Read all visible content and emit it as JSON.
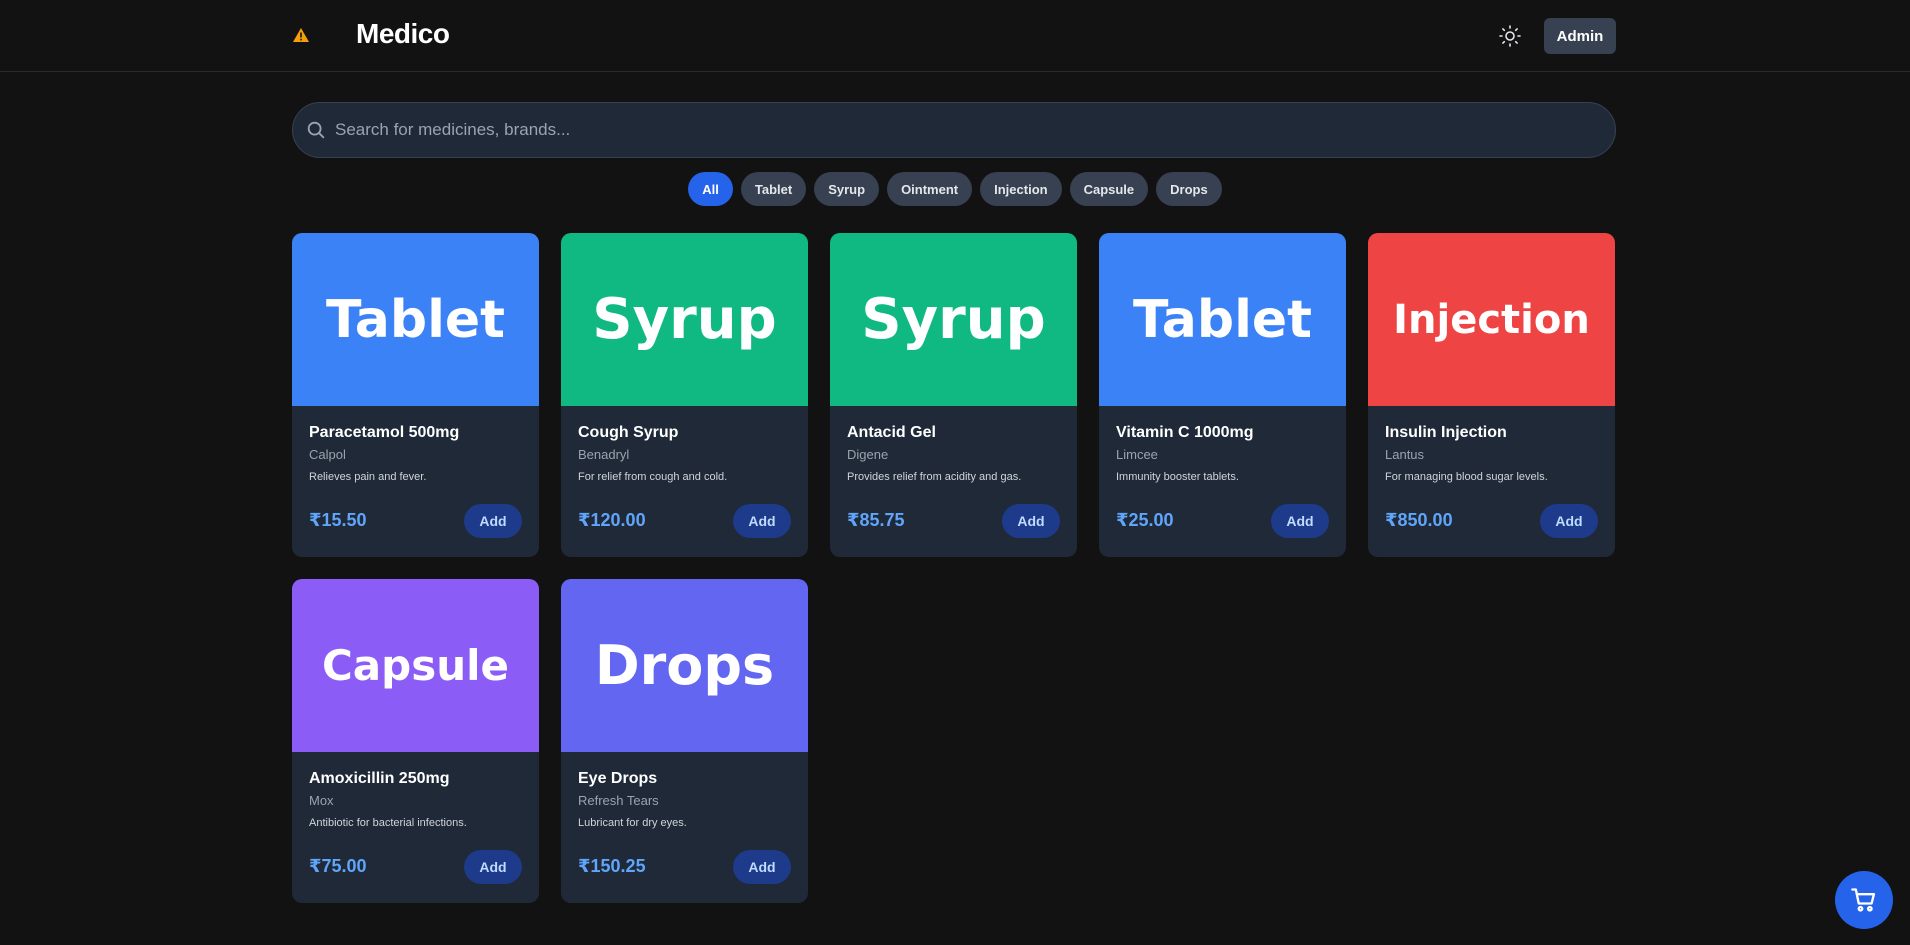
{
  "header": {
    "brand": "Medico",
    "warning_icon": "warning-triangle-icon",
    "theme_icon": "sun-icon",
    "admin_label": "Admin"
  },
  "search": {
    "placeholder": "Search for medicines, brands...",
    "value": ""
  },
  "filters": [
    {
      "label": "All",
      "active": true
    },
    {
      "label": "Tablet",
      "active": false
    },
    {
      "label": "Syrup",
      "active": false
    },
    {
      "label": "Ointment",
      "active": false
    },
    {
      "label": "Injection",
      "active": false
    },
    {
      "label": "Capsule",
      "active": false
    },
    {
      "label": "Drops",
      "active": false
    }
  ],
  "products": [
    {
      "image_label": "Tablet",
      "color": "#3b82f6",
      "name": "Paracetamol 500mg",
      "brand": "Calpol",
      "description": "Relieves pain and fever.",
      "price": "₹15.50",
      "add_label": "Add"
    },
    {
      "image_label": "Syrup",
      "color": "#10b981",
      "name": "Cough Syrup",
      "brand": "Benadryl",
      "description": "For relief from cough and cold.",
      "price": "₹120.00",
      "add_label": "Add"
    },
    {
      "image_label": "Syrup",
      "color": "#10b981",
      "name": "Antacid Gel",
      "brand": "Digene",
      "description": "Provides relief from acidity and gas.",
      "price": "₹85.75",
      "add_label": "Add"
    },
    {
      "image_label": "Tablet",
      "color": "#3b82f6",
      "name": "Vitamin C 1000mg",
      "brand": "Limcee",
      "description": "Immunity booster tablets.",
      "price": "₹25.00",
      "add_label": "Add"
    },
    {
      "image_label": "Injection",
      "color": "#ef4444",
      "name": "Insulin Injection",
      "brand": "Lantus",
      "description": "For managing blood sugar levels.",
      "price": "₹850.00",
      "add_label": "Add"
    },
    {
      "image_label": "Capsule",
      "color": "#8b5cf6",
      "name": "Amoxicillin 250mg",
      "brand": "Mox",
      "description": "Antibiotic for bacterial infections.",
      "price": "₹75.00",
      "add_label": "Add"
    },
    {
      "image_label": "Drops",
      "color": "#6366f1",
      "name": "Eye Drops",
      "brand": "Refresh Tears",
      "description": "Lubricant for dry eyes.",
      "price": "₹150.25",
      "add_label": "Add"
    }
  ],
  "cart_icon": "cart-icon",
  "colors": {
    "background": "#121212",
    "accent": "#2563eb",
    "card": "#1f2937",
    "price": "#60a5fa"
  }
}
